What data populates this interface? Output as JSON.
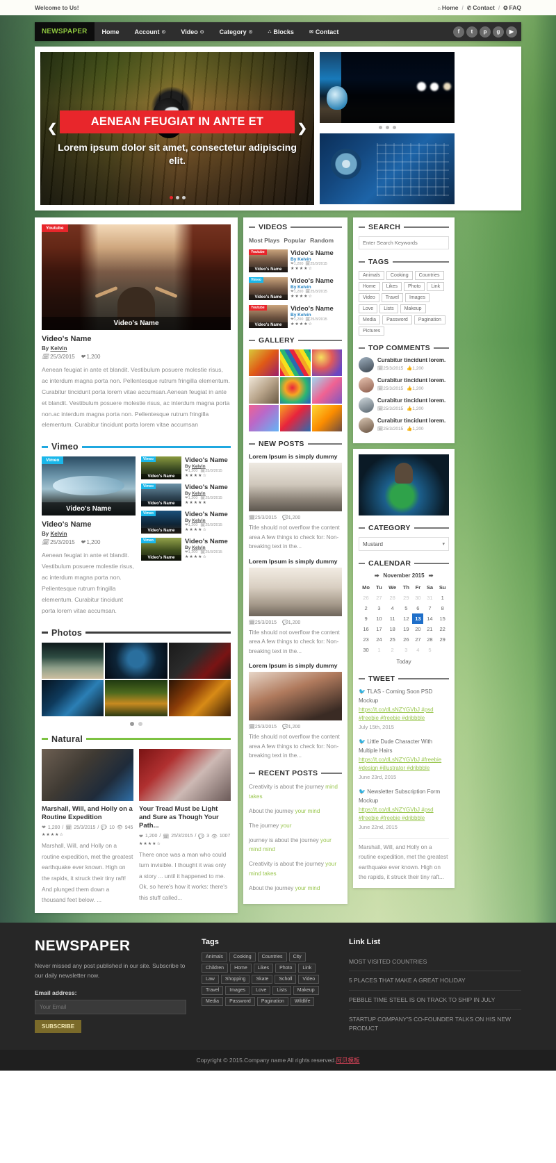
{
  "topbar": {
    "welcome": "Welcome to Us!",
    "links": [
      {
        "icon": "home-icon",
        "glyph": "⌂",
        "label": "Home"
      },
      {
        "icon": "phone-icon",
        "glyph": "✆",
        "label": "Contact"
      },
      {
        "icon": "info-icon",
        "glyph": "✪",
        "label": "FAQ"
      }
    ],
    "separator": "/"
  },
  "nav": {
    "brand": "NEWSPAPER",
    "items": [
      {
        "label": "Home",
        "caret": ""
      },
      {
        "label": "Account",
        "caret": "⊙"
      },
      {
        "label": "Video",
        "caret": "⊙"
      },
      {
        "label": "Category",
        "caret": "⊙"
      },
      {
        "label": "Blocks",
        "caret": "",
        "pre": "⛬"
      },
      {
        "label": "Contact",
        "caret": "",
        "pre": "✉"
      }
    ],
    "social": [
      {
        "name": "facebook-icon",
        "glyph": "f"
      },
      {
        "name": "twitter-icon",
        "glyph": "t"
      },
      {
        "name": "pinterest-icon",
        "glyph": "p"
      },
      {
        "name": "google-plus-icon",
        "glyph": "g"
      },
      {
        "name": "youtube-icon",
        "glyph": "▶"
      }
    ]
  },
  "hero": {
    "title": "AENEAN FEUGIAT IN ANTE ET",
    "subtitle": "Lorem ipsum dolor sit amet, consectetur adipiscing elit.",
    "prev": "❮",
    "next": "❯"
  },
  "feature": {
    "badge": "Youtube",
    "overlay_caption": "Video's Name",
    "title": "Video's Name",
    "by_prefix": "By ",
    "author": "Kelvin",
    "date": "25/3/2015",
    "likes": "1,200",
    "body": "Aenean feugiat in ante et blandit. Vestibulum posuere molestie risus, ac interdum magna porta non. Pellentesque rutrum fringilla elementum. Curabitur tincidunt porta lorem vitae accumsan.Aenean feugiat in ante et blandit. Vestibulum posuere molestie risus, ac interdum magna porta non.ac interdum magna porta non. Pellentesque rutrum fringilla elementum. Curabitur tincidunt porta lorem vitae accumsan"
  },
  "vimeo": {
    "heading": "Vimeo",
    "badge": "Vimeo",
    "main": {
      "overlay_caption": "Video's Name",
      "title": "Video's Name",
      "by_prefix": "By ",
      "author": "Kelvin",
      "date": "25/3/2015",
      "likes": "1,200",
      "body": "Aenean feugiat in ante et blandit. Vestibulum posuere molestie risus, ac interdum magna porta non. Pellentesque rutrum fringilla elementum. Curabitur tincidunt porta lorem vitae accumsan."
    },
    "list": [
      {
        "title": "Video's Name",
        "author": "Kelvin",
        "likes": "1,200",
        "date": "25/3/2015",
        "stars": "★★★★☆"
      },
      {
        "title": "Video's Name",
        "author": "Kelvin",
        "likes": "1,200",
        "date": "25/3/2015",
        "stars": "★★★★★"
      },
      {
        "title": "Video's Name",
        "author": "Kelvin",
        "likes": "1,200",
        "date": "25/3/2015",
        "stars": "★★★★☆"
      },
      {
        "title": "Video's Name",
        "author": "Kelvin",
        "likes": "1,200",
        "date": "25/3/2015",
        "stars": "★★★★☆"
      }
    ]
  },
  "photos": {
    "heading": "Photos"
  },
  "natural": {
    "heading": "Natural",
    "posts": [
      {
        "title": "Marshall, Will, and Holly on a Routine Expedition",
        "likes": "1,200",
        "date": "25/3/2015",
        "comments": "10",
        "views": "945",
        "stars": "★★★★☆",
        "text": "Marshall, Will, and Holly on a routine expedition, met the greatest earthquake ever known. High on the rapids, it struck their tiny raft! And plunged them down a thousand feet below. ..."
      },
      {
        "title": "Your Tread Must be Light and Sure as Though Your Path...",
        "likes": "1,200",
        "date": "25/3/2015",
        "comments": "3",
        "views": "1007",
        "stars": "★★★★☆",
        "text": "There once was a man who could turn invisible. I thought it was only a story ... until it happened to me. Ok, so here's how it works: there's this stuff called..."
      }
    ]
  },
  "videos_widget": {
    "heading": "VIDEOS",
    "tabs": [
      "Most Plays",
      "Popular",
      "Random"
    ],
    "items": [
      {
        "badge": "Youtube",
        "badge_type": "yt",
        "caption": "Video's Name",
        "title": "Video's Name",
        "author": "Kelvin",
        "likes": "1,200",
        "date": "25/3/2015",
        "stars": "★★★★☆"
      },
      {
        "badge": "Vimeo",
        "badge_type": "vm",
        "caption": "Video's Name",
        "title": "Video's Name",
        "author": "Kelvin",
        "likes": "1,200",
        "date": "25/3/2015",
        "stars": "★★★★☆"
      },
      {
        "badge": "Youtube",
        "badge_type": "yt",
        "caption": "Video's Name",
        "title": "Video's Name",
        "author": "Kelvin",
        "likes": "1,200",
        "date": "25/3/2015",
        "stars": "★★★★☆"
      }
    ]
  },
  "gallery": {
    "heading": "GALLERY"
  },
  "new_posts": {
    "heading": "NEW POSTS",
    "items": [
      {
        "title": "Lorem Ipsum is simply dummy",
        "date": "25/3/2015",
        "comments": "1,200",
        "text": "Title should not overflow the content area A few things to check for: Non-breaking text in the..."
      },
      {
        "title": "Lorem Ipsum is simply dummy",
        "date": "25/3/2015",
        "comments": "1,200",
        "text": "Title should not overflow the content area A few things to check for: Non-breaking text in the..."
      },
      {
        "title": "Lorem Ipsum is simply dummy",
        "date": "25/3/2015",
        "comments": "1,200",
        "text": "Title should not overflow the content area A few things to check for: Non-breaking text in the..."
      }
    ]
  },
  "recent_posts": {
    "heading": "RECENT POSTS",
    "items": [
      {
        "plain": "Creativity is about the journey ",
        "green": "mind takes"
      },
      {
        "plain": "About the journey ",
        "green": "your mind"
      },
      {
        "plain": "The journey ",
        "green": "your"
      },
      {
        "plain": "journey is about the journey ",
        "green": "your mind mind"
      },
      {
        "plain": "Creativity is about the journey ",
        "green": "your mind takes"
      },
      {
        "plain": "About the journey ",
        "green": "your mind"
      }
    ]
  },
  "search": {
    "heading": "SEARCH",
    "placeholder": "Enter Search Keywords",
    "value": ""
  },
  "tags_widget": {
    "heading": "TAGS",
    "items": [
      "Animals",
      "Cooking",
      "Countries",
      "Home",
      "Likes",
      "Photo",
      "Link",
      "Video",
      "Travel",
      "Images",
      "Love",
      "Lists",
      "Makeup",
      "Media",
      "Password",
      "Pagination",
      "Pictures"
    ]
  },
  "top_comments": {
    "heading": "TOP COMMENTS",
    "items": [
      {
        "text": "Curabitur tincidunt lorem.",
        "date": "25/3/2015",
        "likes": "1,200"
      },
      {
        "text": "Curabitur tincidunt lorem.",
        "date": "25/3/2015",
        "likes": "1,200"
      },
      {
        "text": "Curabitur tincidunt lorem.",
        "date": "25/3/2015",
        "likes": "1,200"
      },
      {
        "text": "Curabitur tincidunt lorem.",
        "date": "25/3/2015",
        "likes": "1,200"
      }
    ]
  },
  "category": {
    "heading": "CATEGORY",
    "selected": "Mustard"
  },
  "calendar": {
    "heading": "CALENDAR",
    "month": "November 2015",
    "prev": "➡",
    "next": "➡",
    "weekdays": [
      "Mo",
      "Tu",
      "We",
      "Th",
      "Fr",
      "Sa",
      "Su"
    ],
    "weeks": [
      [
        {
          "d": "26",
          "t": "mut"
        },
        {
          "d": "27",
          "t": "mut"
        },
        {
          "d": "28",
          "t": "mut"
        },
        {
          "d": "29",
          "t": "mut"
        },
        {
          "d": "30",
          "t": "mut"
        },
        {
          "d": "31",
          "t": "mut"
        },
        {
          "d": "1",
          "t": ""
        }
      ],
      [
        {
          "d": "2",
          "t": ""
        },
        {
          "d": "3",
          "t": ""
        },
        {
          "d": "4",
          "t": ""
        },
        {
          "d": "5",
          "t": ""
        },
        {
          "d": "6",
          "t": ""
        },
        {
          "d": "7",
          "t": ""
        },
        {
          "d": "8",
          "t": ""
        }
      ],
      [
        {
          "d": "9",
          "t": ""
        },
        {
          "d": "10",
          "t": ""
        },
        {
          "d": "11",
          "t": ""
        },
        {
          "d": "12",
          "t": ""
        },
        {
          "d": "13",
          "t": "today"
        },
        {
          "d": "14",
          "t": ""
        },
        {
          "d": "15",
          "t": ""
        }
      ],
      [
        {
          "d": "16",
          "t": ""
        },
        {
          "d": "17",
          "t": ""
        },
        {
          "d": "18",
          "t": ""
        },
        {
          "d": "19",
          "t": ""
        },
        {
          "d": "20",
          "t": ""
        },
        {
          "d": "21",
          "t": ""
        },
        {
          "d": "22",
          "t": ""
        }
      ],
      [
        {
          "d": "23",
          "t": ""
        },
        {
          "d": "24",
          "t": ""
        },
        {
          "d": "25",
          "t": ""
        },
        {
          "d": "26",
          "t": ""
        },
        {
          "d": "27",
          "t": ""
        },
        {
          "d": "28",
          "t": ""
        },
        {
          "d": "29",
          "t": ""
        }
      ],
      [
        {
          "d": "30",
          "t": ""
        },
        {
          "d": "1",
          "t": "mut"
        },
        {
          "d": "2",
          "t": "mut"
        },
        {
          "d": "3",
          "t": "mut"
        },
        {
          "d": "4",
          "t": "mut"
        },
        {
          "d": "5",
          "t": "mut"
        },
        {
          "d": "",
          "t": ""
        }
      ]
    ],
    "today_label": "Today"
  },
  "tweet": {
    "heading": "TWEET",
    "items": [
      {
        "text": "TLAS - Coming Soon PSD Mockup",
        "link": "https://t.co/dLsNZYGVbJ #psd #freebie #freebie #dribbble",
        "date": "July 15th, 2015"
      },
      {
        "text": "Little Dude Character With Multiple Hairs",
        "link": "https://t.co/dLsNZYGVbJ #freebie #design #illustrator #dribbble",
        "date": "June 23rd, 2015"
      },
      {
        "text": "Newsletter Subscription Form Mockup",
        "link": "https://t.co/dLsNZYGVbJ #psd #freebie #freebie #dribbble",
        "date": "June 22nd, 2015"
      }
    ],
    "footer_text": "Marshall, Will, and Holly on a routine expedition, met the greatest earthquake ever known. High on the rapids, it struck their tiny raft..."
  },
  "footer": {
    "brand": "NEWSPAPER",
    "about": "Never missed any post published in our site. Subscribe to our daily newsletter now.",
    "email_label": "Email address:",
    "email_placeholder": "Your Email",
    "subscribe": "SUBSCRIBE",
    "tags_title": "Tags",
    "tags": [
      "Animals",
      "Cooking",
      "Countries",
      "City",
      "Children",
      "Home",
      "Likes",
      "Photo",
      "Link",
      "Law",
      "Shopping",
      "Skate",
      "Scholl",
      "Video",
      "Travel",
      "Images",
      "Love",
      "Lists",
      "Makeup",
      "Media",
      "Password",
      "Pagination",
      "Wildlife"
    ],
    "linklist_title": "Link List",
    "links": [
      "MOST VISITED COUNTRIES",
      "5 PLACES THAT MAKE A GREAT HOLIDAY",
      "PEBBLE TIME STEEL IS ON TRACK TO SHIP IN JULY",
      "STARTUP COMPANY'S CO-FOUNDER TALKS ON HIS NEW PRODUCT"
    ]
  },
  "copyright": {
    "text": "Copyright © 2015.Company name All rights reserved.",
    "credit": "阿贝模板"
  }
}
